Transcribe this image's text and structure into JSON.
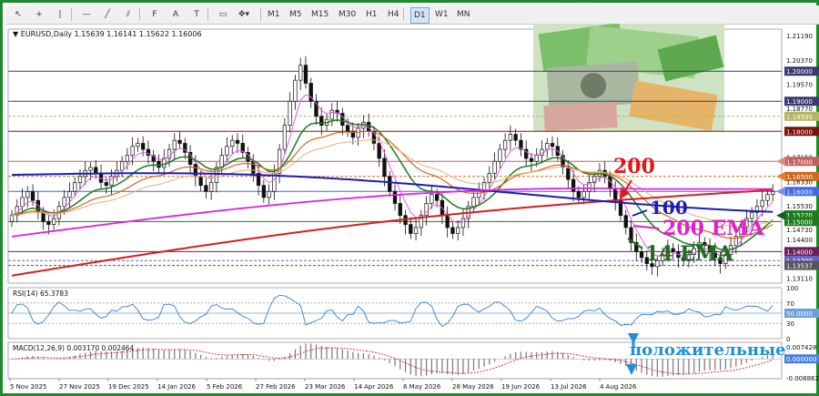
{
  "toolbar": {
    "tools": [
      {
        "name": "cursor-icon",
        "glyph": "↖"
      },
      {
        "name": "crosshair-icon",
        "glyph": "+"
      },
      {
        "name": "vertical-line-icon",
        "glyph": "|"
      },
      {
        "name": "horizontal-line-icon",
        "glyph": "—"
      },
      {
        "name": "trendline-icon",
        "glyph": "╱"
      },
      {
        "name": "equidistant-channel-icon",
        "glyph": "⫽"
      },
      {
        "name": "fibonacci-icon",
        "glyph": "F"
      },
      {
        "name": "text-tool-icon",
        "glyph": "A"
      },
      {
        "name": "text-label-icon",
        "glyph": "T"
      },
      {
        "name": "rectangle-icon",
        "glyph": "▭"
      },
      {
        "name": "shapes-dropdown-icon",
        "glyph": "✥▾"
      }
    ],
    "timeframes": [
      "M1",
      "M5",
      "M15",
      "M30",
      "H1",
      "H4",
      "D1",
      "W1",
      "MN"
    ],
    "active_timeframe": "D1"
  },
  "chart_data": [
    {
      "type": "candlestick",
      "symbol_line": "EURUSD,Daily  1.15639 1.16141 1.15622 1.16006",
      "ohlc_last": {
        "open": 1.15639,
        "high": 1.16141,
        "low": 1.15622,
        "close": 1.16006
      },
      "ylim": [
        1.1295,
        1.214
      ],
      "ytick_labels": [
        {
          "v": 1.2119,
          "t": "1.21190"
        },
        {
          "v": 1.2037,
          "t": "1.20370"
        },
        {
          "v": 1.2,
          "t": "1.20000",
          "box": "#3a3a6e"
        },
        {
          "v": 1.1957,
          "t": "1.19570"
        },
        {
          "v": 1.19,
          "t": "1.19000",
          "box": "#3a3a6e"
        },
        {
          "v": 1.1877,
          "t": "1.18770"
        },
        {
          "v": 1.185,
          "t": "1.18500",
          "box": "#b5b562"
        },
        {
          "v": 1.18,
          "t": "1.18000",
          "box": "#7a1010"
        },
        {
          "v": 1.1715,
          "t": "1.17150"
        },
        {
          "v": 1.17,
          "t": "1.17000",
          "box": "#c06060"
        },
        {
          "v": 1.165,
          "t": "1.16500",
          "box": "#d2691e"
        },
        {
          "v": 1.1633,
          "t": "1.16330"
        },
        {
          "v": 1.16,
          "t": "1.16000",
          "box": "#4169e1"
        },
        {
          "v": 1.1553,
          "t": "1.15530"
        },
        {
          "v": 1.1522,
          "t": "1.15220",
          "box": "#1e7a1e"
        },
        {
          "v": 1.15,
          "t": "1.15000",
          "box": "#1e7a1e"
        },
        {
          "v": 1.1473,
          "t": "1.14730"
        },
        {
          "v": 1.144,
          "t": "1.14400"
        },
        {
          "v": 1.14,
          "t": "1.14000",
          "box": "#6b1f5a"
        },
        {
          "v": 1.137,
          "t": "1.13700",
          "box": "#6464c8"
        },
        {
          "v": 1.13537,
          "t": "1.13537",
          "box": "#555555"
        },
        {
          "v": 1.1311,
          "t": "1.13110"
        }
      ],
      "horizontal_levels": [
        {
          "v": 1.2,
          "color": "#3a3a6e",
          "dash": false
        },
        {
          "v": 1.19,
          "color": "#3a3a6e",
          "dash": false
        },
        {
          "v": 1.185,
          "color": "#b5b562",
          "dash": true
        },
        {
          "v": 1.18,
          "color": "#7a1010",
          "dash": false
        },
        {
          "v": 1.17,
          "color": "#c06060",
          "dash": false
        },
        {
          "v": 1.165,
          "color": "#d2691e",
          "dash": true
        },
        {
          "v": 1.16,
          "color": "#4169e1",
          "dash": false
        },
        {
          "v": 1.15,
          "color": "#1e7a1e",
          "dash": false
        },
        {
          "v": 1.14,
          "color": "#6b1f5a",
          "dash": false
        },
        {
          "v": 1.137,
          "color": "#6464c8",
          "dash": true
        },
        {
          "v": 1.13537,
          "color": "#555555",
          "dash": true
        }
      ],
      "closes": [
        1.152,
        1.155,
        1.158,
        1.16,
        1.157,
        1.153,
        1.15,
        1.149,
        1.151,
        1.155,
        1.158,
        1.16,
        1.163,
        1.165,
        1.167,
        1.168,
        1.166,
        1.163,
        1.162,
        1.165,
        1.167,
        1.17,
        1.172,
        1.175,
        1.176,
        1.174,
        1.172,
        1.17,
        1.168,
        1.171,
        1.174,
        1.177,
        1.176,
        1.173,
        1.169,
        1.165,
        1.162,
        1.16,
        1.163,
        1.168,
        1.172,
        1.175,
        1.177,
        1.176,
        1.173,
        1.17,
        1.166,
        1.162,
        1.158,
        1.16,
        1.166,
        1.174,
        1.182,
        1.19,
        1.197,
        1.202,
        1.196,
        1.19,
        1.185,
        1.182,
        1.184,
        1.187,
        1.186,
        1.182,
        1.18,
        1.178,
        1.181,
        1.183,
        1.18,
        1.176,
        1.171,
        1.165,
        1.16,
        1.156,
        1.152,
        1.149,
        1.146,
        1.148,
        1.152,
        1.156,
        1.159,
        1.157,
        1.152,
        1.148,
        1.146,
        1.148,
        1.151,
        1.155,
        1.158,
        1.16,
        1.163,
        1.166,
        1.17,
        1.174,
        1.177,
        1.179,
        1.177,
        1.174,
        1.171,
        1.17,
        1.172,
        1.174,
        1.176,
        1.175,
        1.172,
        1.168,
        1.164,
        1.16,
        1.158,
        1.16,
        1.163,
        1.165,
        1.167,
        1.165,
        1.161,
        1.157,
        1.152,
        1.148,
        1.143,
        1.14,
        1.138,
        1.136,
        1.135,
        1.137,
        1.139,
        1.141,
        1.14,
        1.138,
        1.137,
        1.139,
        1.141,
        1.143,
        1.142,
        1.14,
        1.138,
        1.136,
        1.139,
        1.142,
        1.145,
        1.148,
        1.151,
        1.153,
        1.155,
        1.157,
        1.159,
        1.16
      ],
      "moving_averages": [
        {
          "name": "200 EMA",
          "color": "#d42020",
          "start": 1.132,
          "end": 1.1605
        },
        {
          "name": "100",
          "color": "#1c1cb8",
          "start": 1.1655,
          "end": 1.1562
        }
      ],
      "x_labels": [
        "5 Nov 2025",
        "27 Nov 2025",
        "19 Dec 2025",
        "14 Jan 2026",
        "5 Feb 2026",
        "27 Feb 2026",
        "23 Mar 2026",
        "14 Apr 2026",
        "6 May 2026",
        "28 May 2026",
        "19 Jun 2026",
        "13 Jul 2026",
        "4 Aug 2026"
      ],
      "annotations": [
        {
          "text": "200",
          "color": "#e01818"
        },
        {
          "text": "100",
          "color": "#1c1cb8"
        },
        {
          "text": "200 EMA",
          "color": "#e020c8"
        },
        {
          "text": "14 EMA",
          "color": "#1e6e1e"
        }
      ]
    },
    {
      "type": "line",
      "name": "RSI(14) 65.3783",
      "value": 65.3783,
      "ylim": [
        0,
        100
      ],
      "ytick_labels": [
        "100",
        "70",
        "50.0000",
        "30",
        "0"
      ],
      "level_box": "50.0000",
      "annotation": "положительные",
      "annotation_color": "#1e8fe0"
    },
    {
      "type": "bar",
      "name": "MACD(12,26,9) 0.003170 0.002464",
      "macd": 0.00317,
      "signal": 0.002464,
      "ylim": [
        -0.008862,
        0.007428
      ],
      "ytick_labels": [
        "0.007428",
        "0.000000",
        "-0.008862"
      ],
      "zero_box": "0.000000"
    }
  ]
}
